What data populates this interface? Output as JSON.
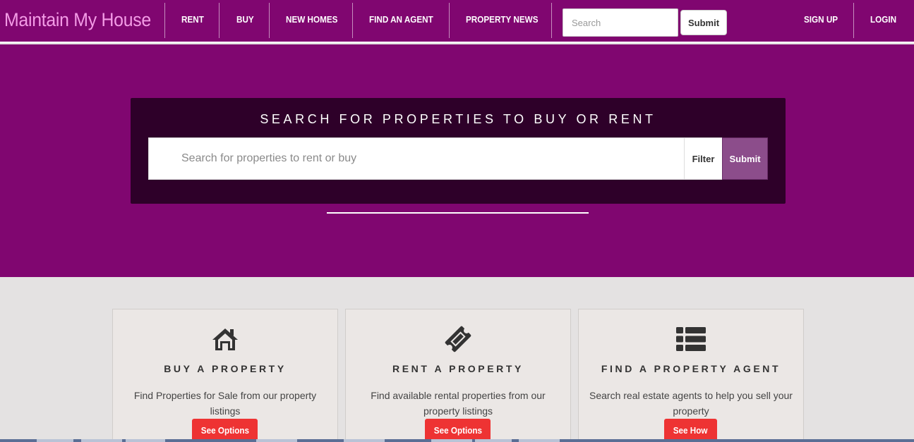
{
  "navbar": {
    "brand": "Maintain My House",
    "links": [
      "RENT",
      "BUY",
      "NEW HOMES",
      "FIND AN AGENT",
      "PROPERTY NEWS"
    ],
    "search_placeholder": "Search",
    "submit_label": "Submit",
    "sign_up": "SIGN UP",
    "login": "LOGIN"
  },
  "hero": {
    "title": "SEARCH FOR PROPERTIES TO BUY OR RENT",
    "search_placeholder": "Search for properties to rent or buy",
    "filter_label": "Filter",
    "submit_label": "Submit"
  },
  "cards": [
    {
      "icon": "home-icon",
      "title": "BUY A PROPERTY",
      "description": "Find Properties for Sale from our property listings",
      "button": "See Options"
    },
    {
      "icon": "ticket-icon",
      "title": "RENT A PROPERTY",
      "description": "Find available rental properties from our property listings",
      "button": "See Options"
    },
    {
      "icon": "list-icon",
      "title": "FIND A PROPERTY AGENT",
      "description": "Search real estate agents to help you sell your property",
      "button": "See How"
    }
  ],
  "colors": {
    "brand_purple": "#800670",
    "panel_dark": "#2e0029",
    "brand_pink": "#f39ce6",
    "hero_submit": "#8c4d8b",
    "cta_red": "#ee3333"
  }
}
